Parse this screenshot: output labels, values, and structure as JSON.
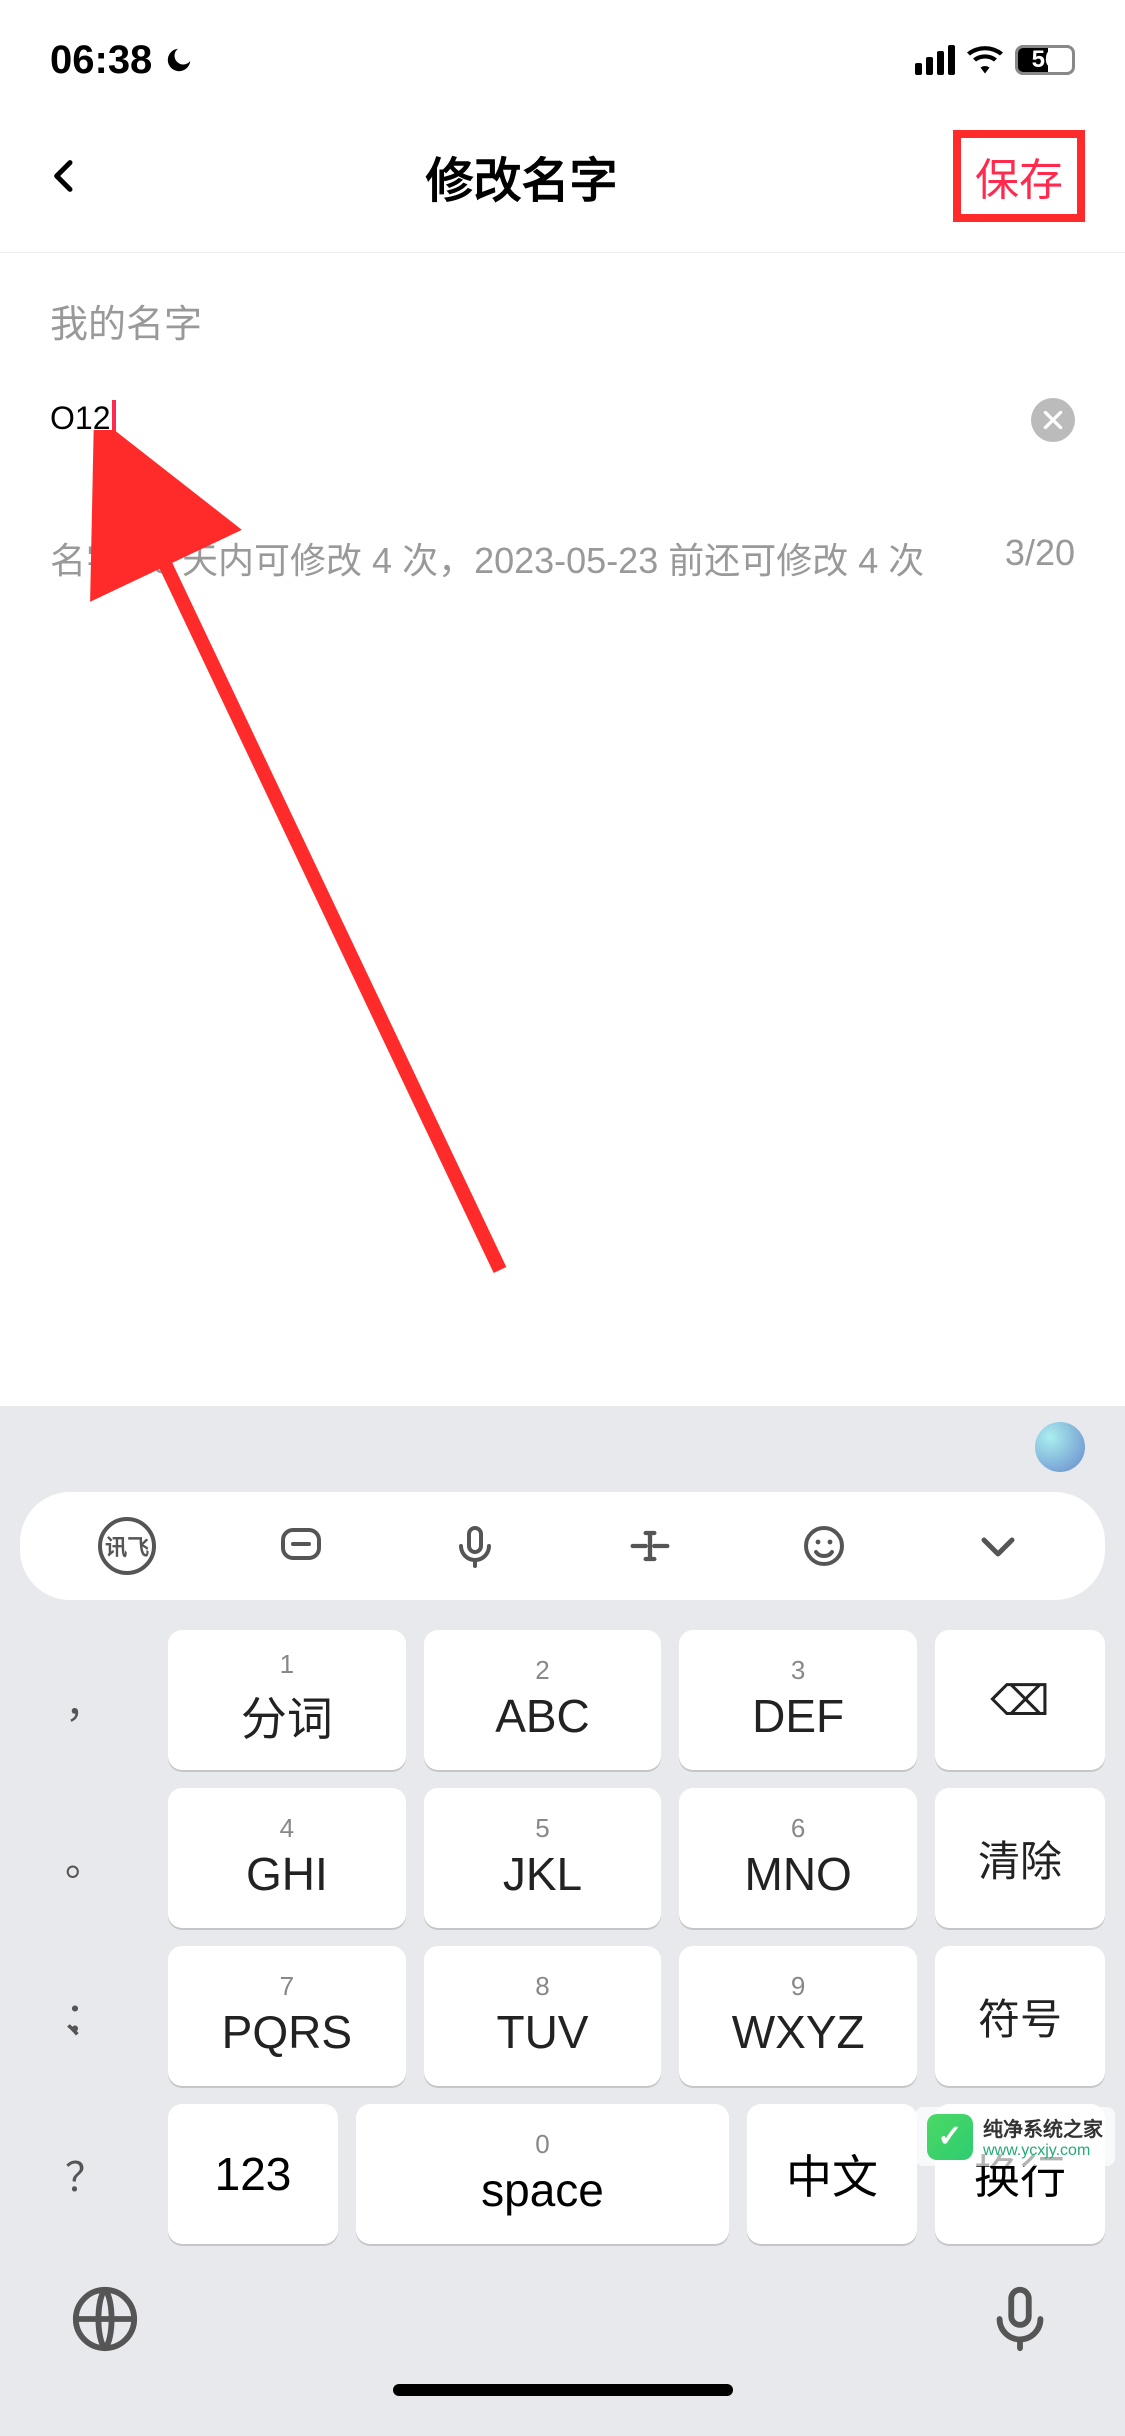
{
  "status": {
    "time": "06:38",
    "battery": "56"
  },
  "nav": {
    "title": "修改名字",
    "save": "保存"
  },
  "form": {
    "label": "我的名字",
    "value": "O12",
    "hint": "名字 30 天内可修改 4 次，2023-05-23 前还可修改 4 次",
    "counter": "3/20"
  },
  "keyboard": {
    "brand": "讯飞",
    "rows": [
      [
        {
          "side": "，"
        },
        {
          "num": "1",
          "label": "分词"
        },
        {
          "num": "2",
          "label": "ABC"
        },
        {
          "num": "3",
          "label": "DEF"
        },
        {
          "func": "backspace",
          "glyph": "⌫"
        }
      ],
      [
        {
          "side": "。"
        },
        {
          "num": "4",
          "label": "GHI"
        },
        {
          "num": "5",
          "label": "JKL"
        },
        {
          "num": "6",
          "label": "MNO"
        },
        {
          "func": "clear",
          "label": "清除"
        }
      ],
      [
        {
          "side": "、"
        },
        {
          "num": "7",
          "label": "PQRS"
        },
        {
          "num": "8",
          "label": "TUV"
        },
        {
          "num": "9",
          "label": "WXYZ"
        },
        {
          "func": "symbol",
          "label": "符号"
        }
      ],
      [
        {
          "side": "："
        }
      ]
    ],
    "spaceRow": {
      "side": "？",
      "numKey": "123",
      "space": {
        "num": "0",
        "label": "space"
      },
      "lang": "中文",
      "enter": "换行"
    }
  },
  "watermark": {
    "title": "纯净系统之家",
    "url": "www.ycxjy.com"
  }
}
